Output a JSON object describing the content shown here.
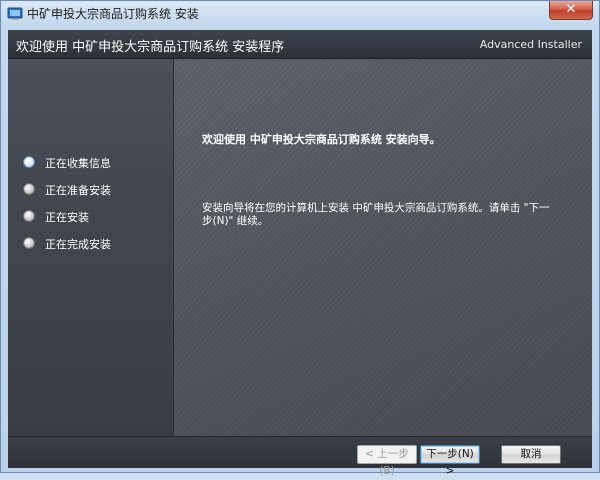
{
  "window": {
    "title": "中矿申投大宗商品订购系统 安装",
    "close_label": "✕"
  },
  "header": {
    "title": "欢迎使用 中矿申投大宗商品订购系统 安装程序",
    "brand": "Advanced Installer"
  },
  "steps": [
    {
      "label": "正在收集信息",
      "active": true
    },
    {
      "label": "正在准备安装",
      "active": false
    },
    {
      "label": "正在安装",
      "active": false
    },
    {
      "label": "正在完成安装",
      "active": false
    }
  ],
  "main": {
    "heading": "欢迎使用 中矿申投大宗商品订购系统 安装向导。",
    "body": "安装向导将在您的计算机上安装 中矿申投大宗商品订购系统。请单击 \"下一步(N)\" 继续。"
  },
  "buttons": {
    "back": "< 上一步(B)",
    "next": "下一步(N) >",
    "cancel": "取消"
  },
  "colors": {
    "header_bg": "#353a41",
    "panel_bg": "#51565d",
    "accent": "#3c7fb1"
  },
  "icons": {
    "app": "installer-app-icon",
    "close": "close-icon"
  }
}
